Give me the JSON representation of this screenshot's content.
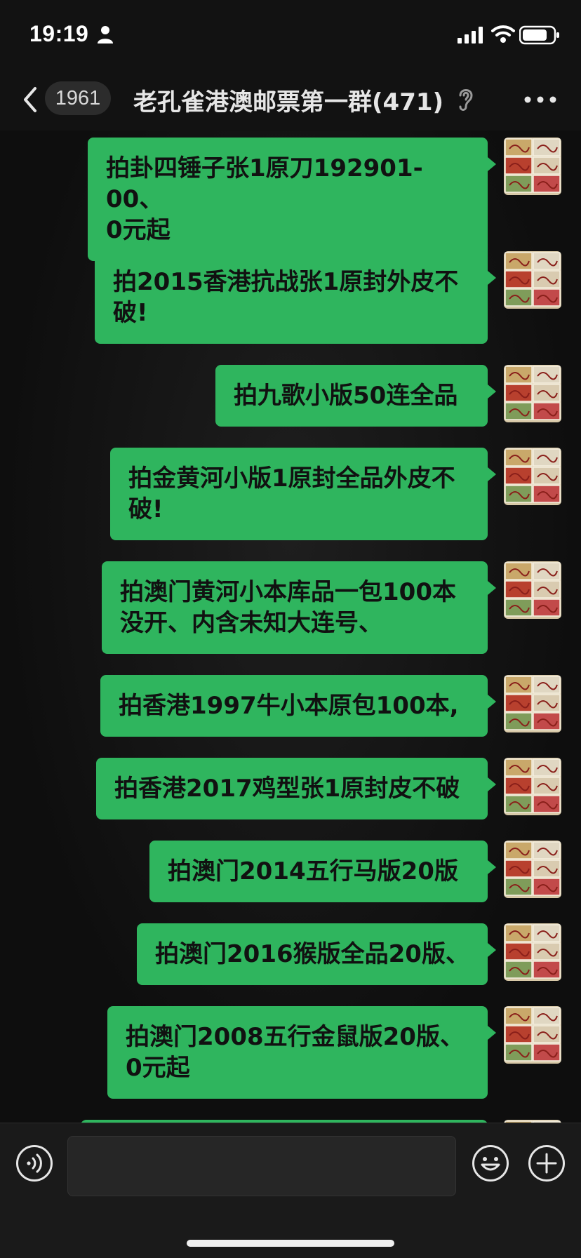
{
  "status_bar": {
    "time": "19:19"
  },
  "nav": {
    "unread_count": "1961",
    "title": "老孔雀港澳邮票第一群(471)"
  },
  "messages": [
    {
      "lines": [
        "拍卦四锤子张1原刀192901-00、",
        "0元起"
      ]
    },
    {
      "lines": [
        "拍2015香港抗战张1原封外皮不",
        "破!"
      ]
    },
    {
      "lines": [
        "拍九歌小版50连全品"
      ]
    },
    {
      "lines": [
        "拍金黄河小版1原封全品外皮不",
        "破!"
      ]
    },
    {
      "lines": [
        "拍澳门黄河小本库品一包100本",
        "没开、内含未知大连号、"
      ]
    },
    {
      "lines": [
        "拍香港1997牛小本原包100本,"
      ]
    },
    {
      "lines": [
        "拍香港2017鸡型张1原封皮不破"
      ]
    },
    {
      "lines": [
        "拍澳门2014五行马版20版"
      ]
    },
    {
      "lines": [
        "拍澳门2016猴版全品20版、"
      ]
    },
    {
      "lines": [
        "拍澳门2008五行金鼠版20版、",
        "0元起"
      ]
    }
  ],
  "colors": {
    "bubble": "#2fb55e",
    "background": "#0e0e0e"
  }
}
